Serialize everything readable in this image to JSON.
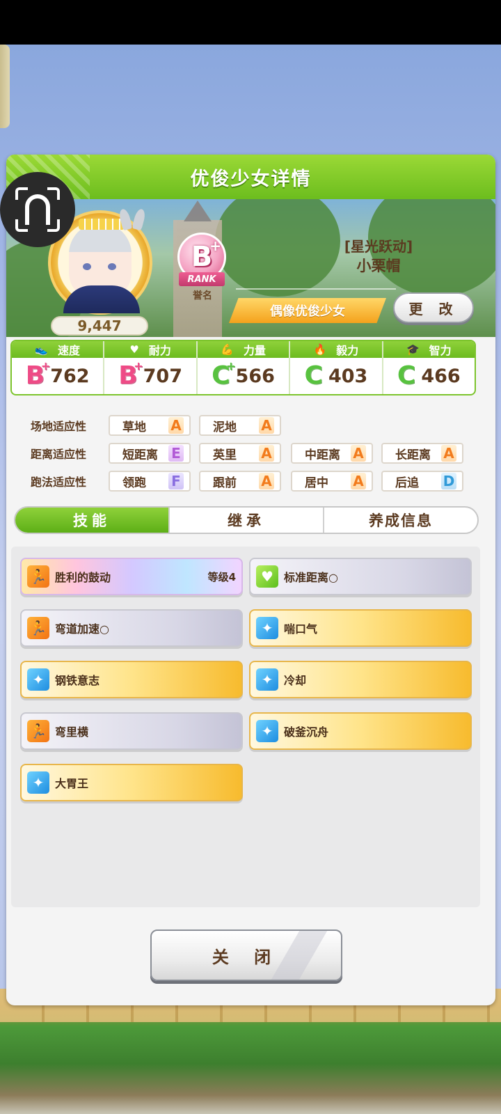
{
  "header": {
    "title": "优俊少女详情"
  },
  "profile": {
    "fans": "9,447",
    "rank_letter": "B",
    "rank_plus": "+",
    "rank_label": "RANK",
    "rank_caption": "誉名",
    "epithet": "[星光跃动]",
    "name": "小栗帽",
    "title": "偶像优俊少女",
    "change_label": "更 改"
  },
  "stats": [
    {
      "icon": "shoe-icon",
      "label": "速度",
      "grade": "B",
      "plus": "+",
      "value": "762",
      "color": "#ee4b86"
    },
    {
      "icon": "heart-icon",
      "label": "耐力",
      "grade": "B",
      "plus": "+",
      "value": "707",
      "color": "#ee4b86"
    },
    {
      "icon": "muscle-icon",
      "label": "力量",
      "grade": "C",
      "plus": "+",
      "value": "566",
      "color": "#58c23f"
    },
    {
      "icon": "flame-icon",
      "label": "毅力",
      "grade": "C",
      "plus": "",
      "value": "403",
      "color": "#58c23f"
    },
    {
      "icon": "grad-cap-icon",
      "label": "智力",
      "grade": "C",
      "plus": "",
      "value": "466",
      "color": "#58c23f"
    }
  ],
  "aptitude": {
    "track": {
      "label": "场地适应性",
      "items": [
        {
          "name": "草地",
          "grade": "A"
        },
        {
          "name": "泥地",
          "grade": "A"
        }
      ]
    },
    "distance": {
      "label": "距离适应性",
      "items": [
        {
          "name": "短距离",
          "grade": "E"
        },
        {
          "name": "英里",
          "grade": "A"
        },
        {
          "name": "中距离",
          "grade": "A"
        },
        {
          "name": "长距离",
          "grade": "A"
        }
      ]
    },
    "style": {
      "label": "跑法适应性",
      "items": [
        {
          "name": "领跑",
          "grade": "F"
        },
        {
          "name": "跟前",
          "grade": "A"
        },
        {
          "name": "居中",
          "grade": "A"
        },
        {
          "name": "后追",
          "grade": "D"
        }
      ]
    }
  },
  "tabs": [
    {
      "label": "技能"
    },
    {
      "label": "继承"
    },
    {
      "label": "养成信息"
    }
  ],
  "skills": [
    {
      "name": "胜利的鼓动",
      "level": "等级4",
      "style": "rainbow",
      "icon": "runner-icon"
    },
    {
      "name": "标准距离○",
      "level": "",
      "style": "gray",
      "icon": "heart-icon"
    },
    {
      "name": "弯道加速○",
      "level": "",
      "style": "gray",
      "icon": "runner-icon"
    },
    {
      "name": "喘口气",
      "level": "",
      "style": "gold",
      "icon": "sparkle-icon"
    },
    {
      "name": "钢铁意志",
      "level": "",
      "style": "gold",
      "icon": "sparkle-icon"
    },
    {
      "name": "冷却",
      "level": "",
      "style": "gold",
      "icon": "sparkle-icon"
    },
    {
      "name": "弯里横",
      "level": "",
      "style": "gray",
      "icon": "runner-icon"
    },
    {
      "name": "破釜沉舟",
      "level": "",
      "style": "gold",
      "icon": "sparkle-icon"
    },
    {
      "name": "大胃王",
      "level": "",
      "style": "gold",
      "icon": "sparkle-icon"
    }
  ],
  "close_label": "关 闭"
}
